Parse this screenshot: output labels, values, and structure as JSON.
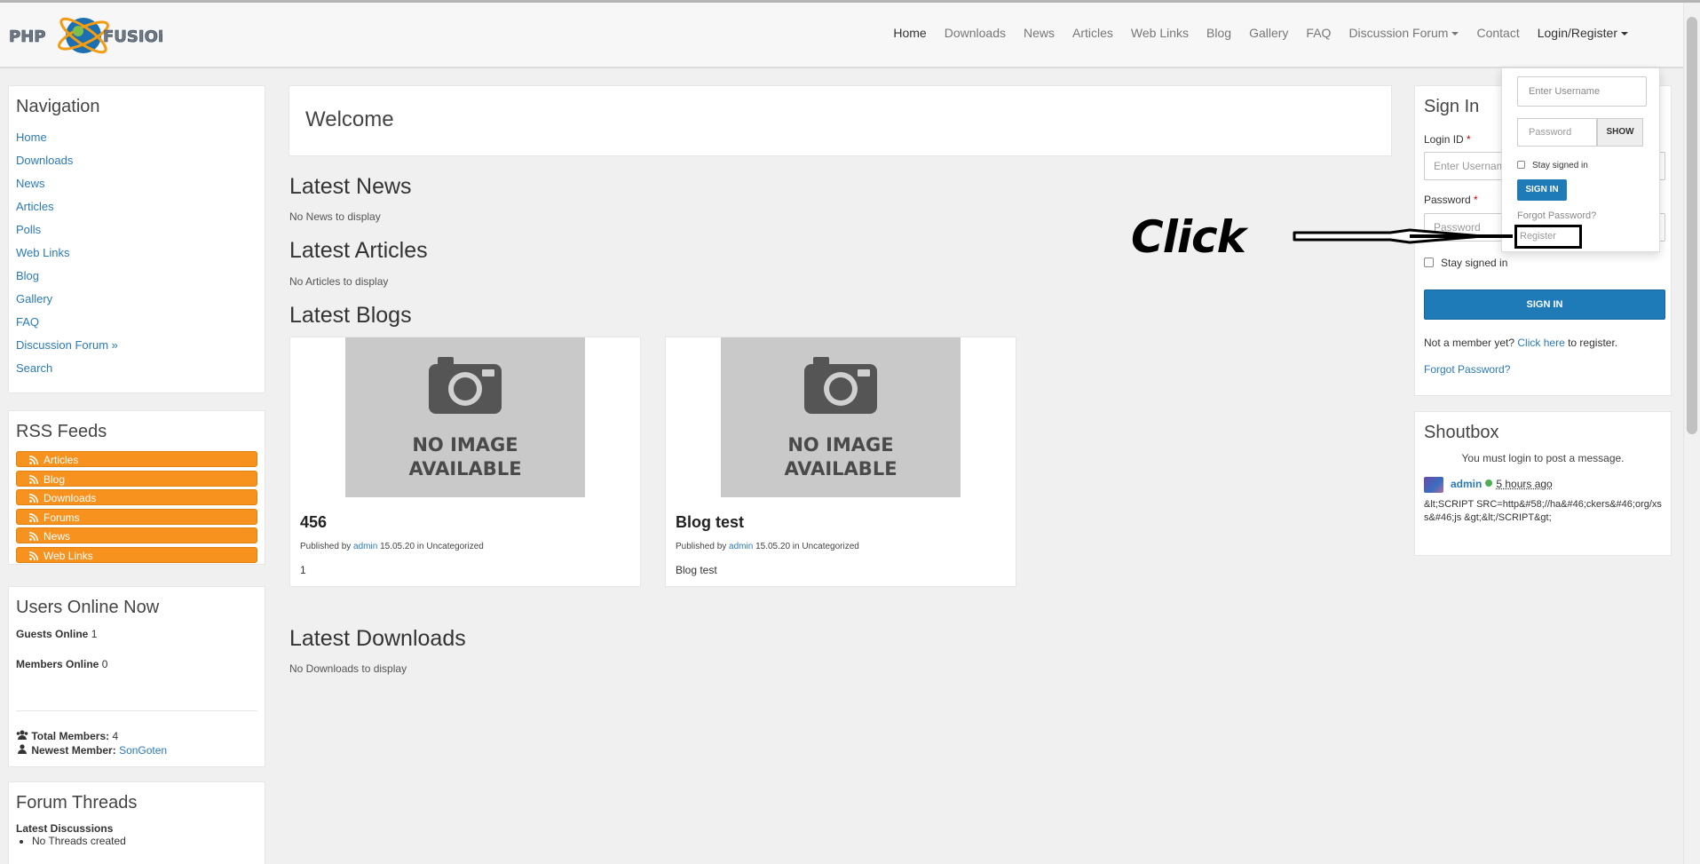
{
  "brand": {
    "logo_text": "PHP FUSION"
  },
  "topnav": {
    "items": [
      "Home",
      "Downloads",
      "News",
      "Articles",
      "Web Links",
      "Blog",
      "Gallery",
      "FAQ",
      "Discussion Forum",
      "Contact"
    ],
    "login": "Login/Register"
  },
  "navigation": {
    "title": "Navigation",
    "items": [
      "Home",
      "Downloads",
      "News",
      "Articles",
      "Polls",
      "Web Links",
      "Blog",
      "Gallery",
      "FAQ",
      "Discussion Forum »",
      "Search"
    ]
  },
  "rss": {
    "title": "RSS Feeds",
    "items": [
      "Articles",
      "Blog",
      "Downloads",
      "Forums",
      "News",
      "Web Links"
    ],
    "color": "#f7921e"
  },
  "users_online": {
    "title": "Users Online Now",
    "guests_label": "Guests Online",
    "guests": "1",
    "members_label": "Members Online",
    "members": "0",
    "total_label": "Total Members:",
    "total": "4",
    "newest_label": "Newest Member:",
    "newest": "SonGoten"
  },
  "forum_threads": {
    "title": "Forum Threads",
    "sub": "Latest Discussions",
    "item": "No Threads created"
  },
  "main": {
    "welcome": "Welcome",
    "latest_news": {
      "title": "Latest News",
      "note": "No News to display"
    },
    "latest_articles": {
      "title": "Latest Articles",
      "note": "No Articles to display"
    },
    "latest_blogs": {
      "title": "Latest Blogs",
      "no_image_1": "NO IMAGE",
      "no_image_2": "AVAILABLE",
      "posts": [
        {
          "title": "456",
          "published_by": "Published by",
          "author": "admin",
          "date": "15.05.20 in Uncategorized",
          "body": "1"
        },
        {
          "title": "Blog test",
          "published_by": "Published by",
          "author": "admin",
          "date": "15.05.20 in Uncategorized",
          "body": "Blog test"
        }
      ]
    },
    "latest_downloads": {
      "title": "Latest Downloads",
      "note": "No Downloads to display"
    }
  },
  "signin": {
    "title": "Sign In",
    "login_label": "Login ID",
    "login_placeholder": "Enter Username",
    "password_label": "Password",
    "password_placeholder": "Password",
    "stay": "Stay signed in",
    "button": "SIGN IN",
    "not_member": "Not a member yet?",
    "click_here": "Click here",
    "to_register": "to register.",
    "forgot": "Forgot Password?"
  },
  "shoutbox": {
    "title": "Shoutbox",
    "message": "You must login to post a message.",
    "author": "admin",
    "time": "5 hours ago",
    "text": "&lt;SCRIPT SRC=http&#58;//ha&#46;ckers&#46;org/xss&#46;js &gt;&lt;/SCRIPT&gt;"
  },
  "dropdown": {
    "username_placeholder": "Enter Username",
    "password_placeholder": "Password",
    "show": "SHOW",
    "stay": "Stay signed in",
    "signin": "SIGN IN",
    "forgot": "Forgot Password?",
    "register": "Register"
  },
  "annotation": {
    "label": "Click"
  },
  "colors": {
    "accent": "#1f7ab8",
    "link": "#2a7ab8",
    "rss": "#f7921e"
  }
}
